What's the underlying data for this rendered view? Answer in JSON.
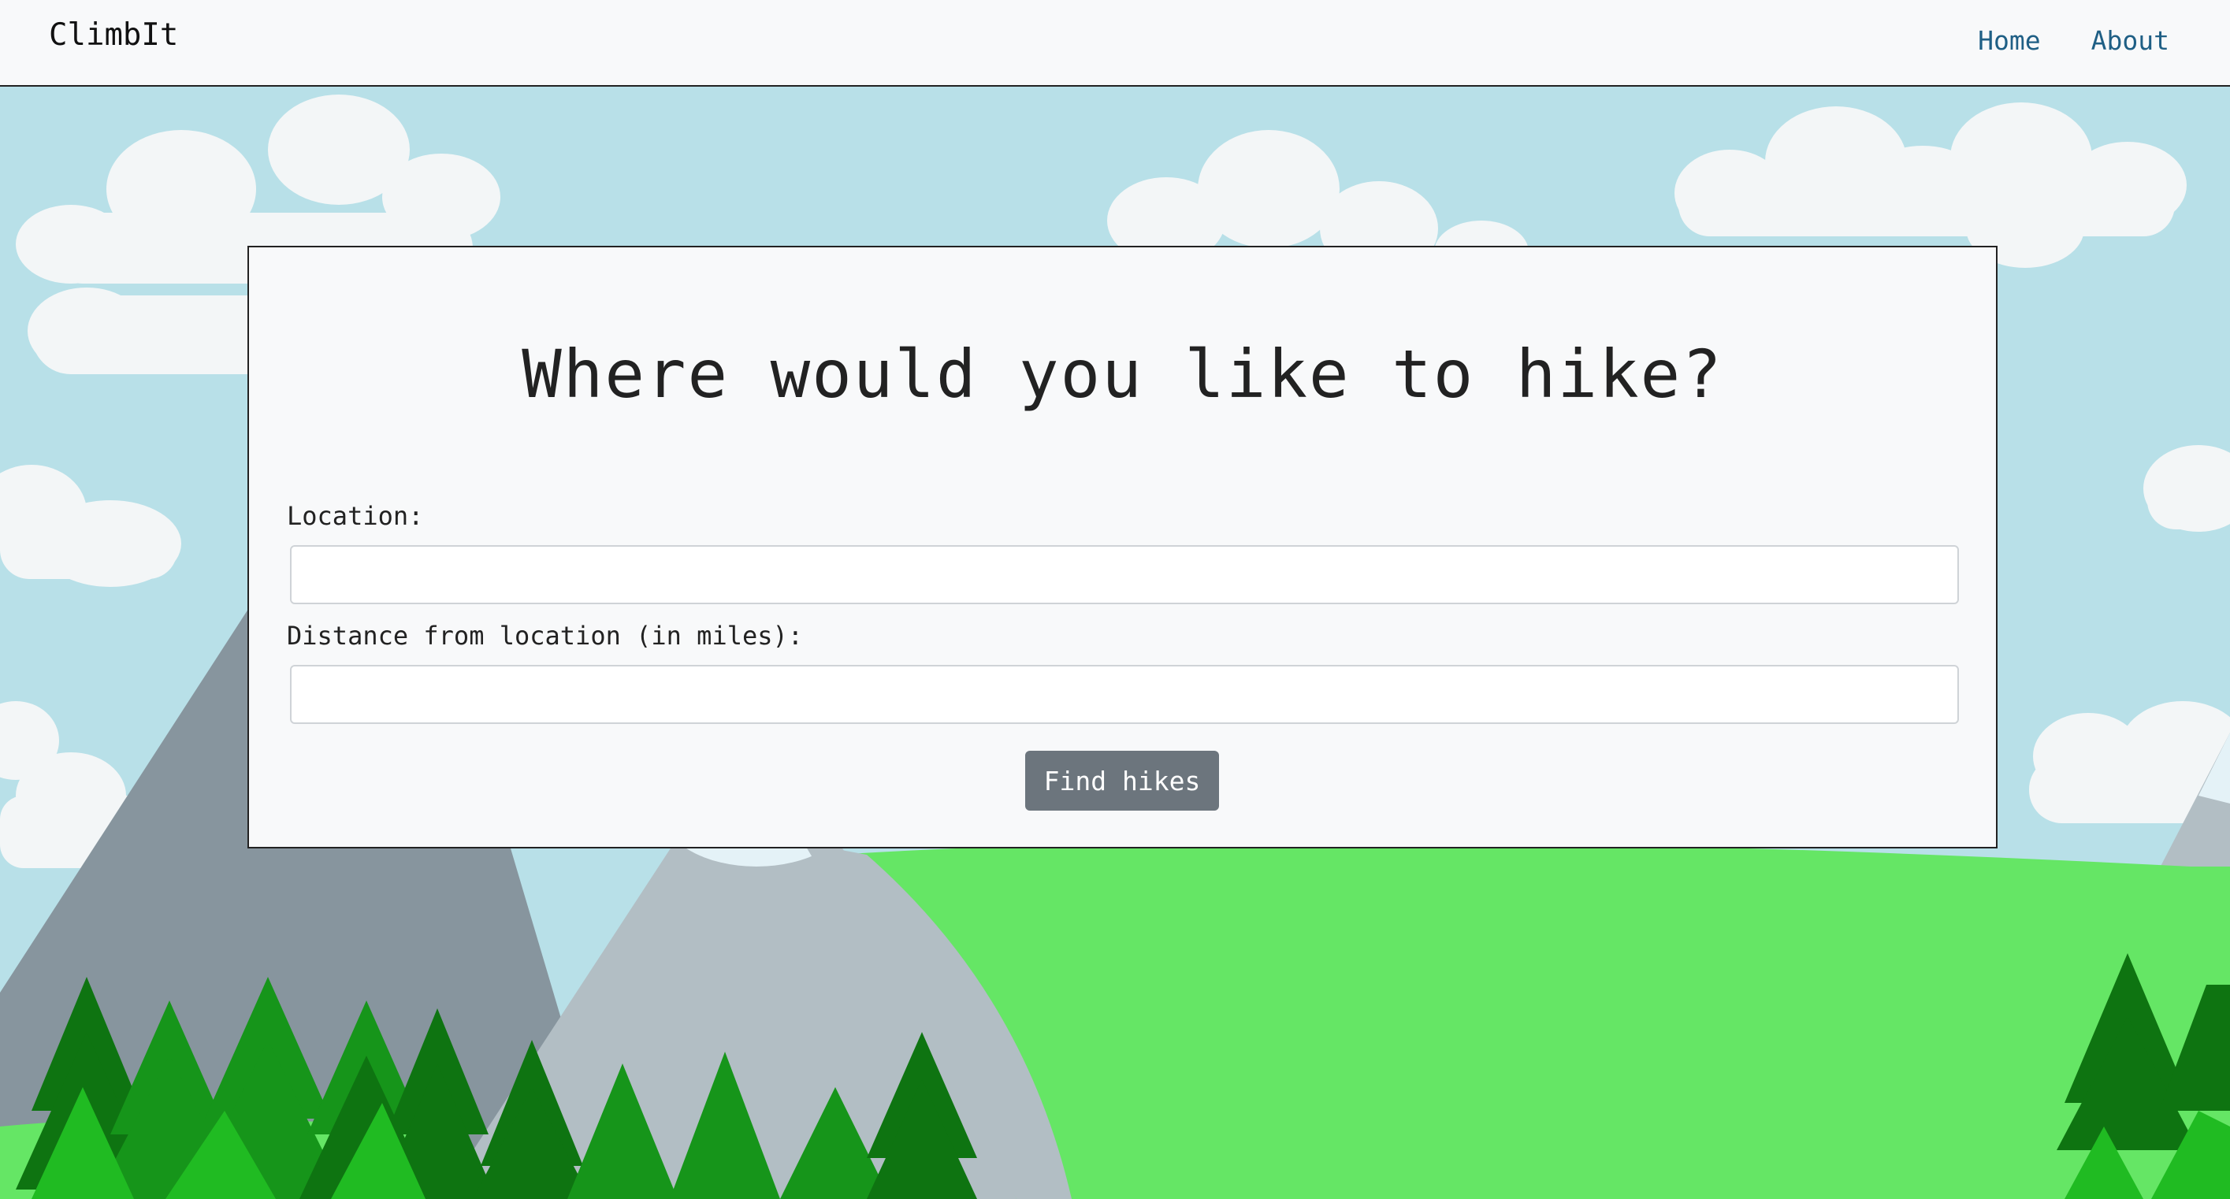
{
  "navbar": {
    "brand": "ClimbIt",
    "links": [
      {
        "label": "Home"
      },
      {
        "label": "About"
      }
    ]
  },
  "form": {
    "title": "Where would you like to hike?",
    "location_label": "Location:",
    "location_value": "",
    "distance_label": "Distance from location (in miles):",
    "distance_value": "",
    "submit_label": "Find hikes"
  },
  "colors": {
    "sky": "#b8e0e8",
    "cloud": "#f3f6f7",
    "grass": "#65e665",
    "mountain_dark": "#87959e",
    "mountain_light": "#b2bec4",
    "snow": "#e4f2f7",
    "tree_dark": "#0e7411",
    "tree_mid": "#16951a",
    "tree_light": "#20bb22",
    "button": "#6c757d",
    "link": "#1f5f85"
  }
}
